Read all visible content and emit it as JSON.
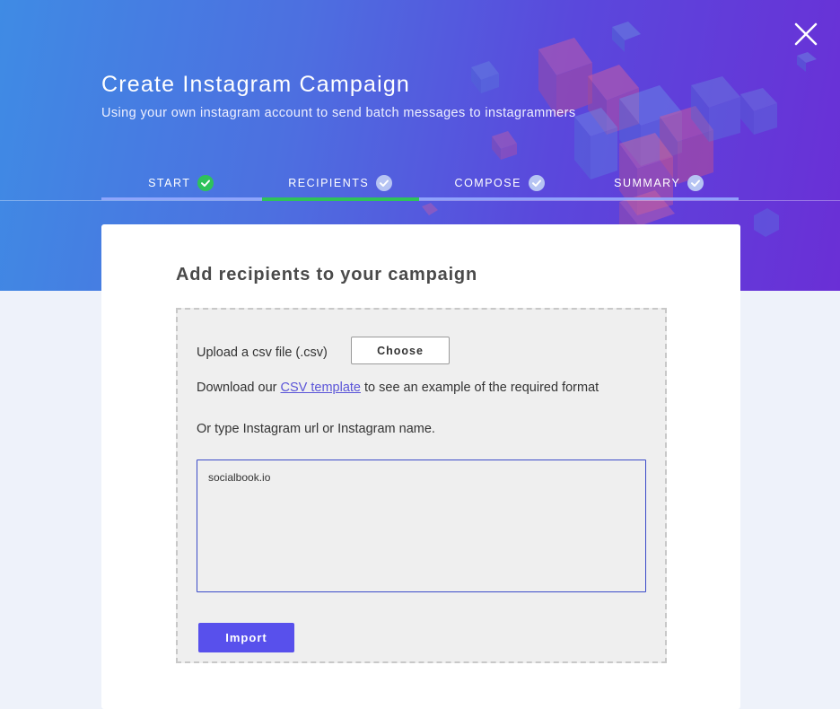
{
  "header": {
    "title": "Create Instagram Campaign",
    "subtitle": "Using your own instagram account to send batch messages to instagrammers"
  },
  "steps": [
    {
      "label": "START",
      "state": "complete",
      "icon": "check-circle-icon"
    },
    {
      "label": "RECIPIENTS",
      "state": "active",
      "icon": "check-circle-icon"
    },
    {
      "label": "COMPOSE",
      "state": "pending",
      "icon": "check-circle-icon"
    },
    {
      "label": "SUMMARY",
      "state": "pending",
      "icon": "check-circle-icon"
    }
  ],
  "card": {
    "title": "Add recipients to your campaign",
    "upload_label": "Upload a csv file (.csv)",
    "choose_label": "Choose",
    "download_prefix": "Download our",
    "csv_link": "CSV template",
    "download_suffix": "to see an example of the required format",
    "or_text": "Or type Instagram url or Instagram name.",
    "input_value": "socialbook.io",
    "import_label": "Import"
  },
  "colors": {
    "accent": "#5850ec",
    "complete": "#2fc25a",
    "hero_start": "#3f8be4",
    "hero_end": "#6a2fd6"
  }
}
